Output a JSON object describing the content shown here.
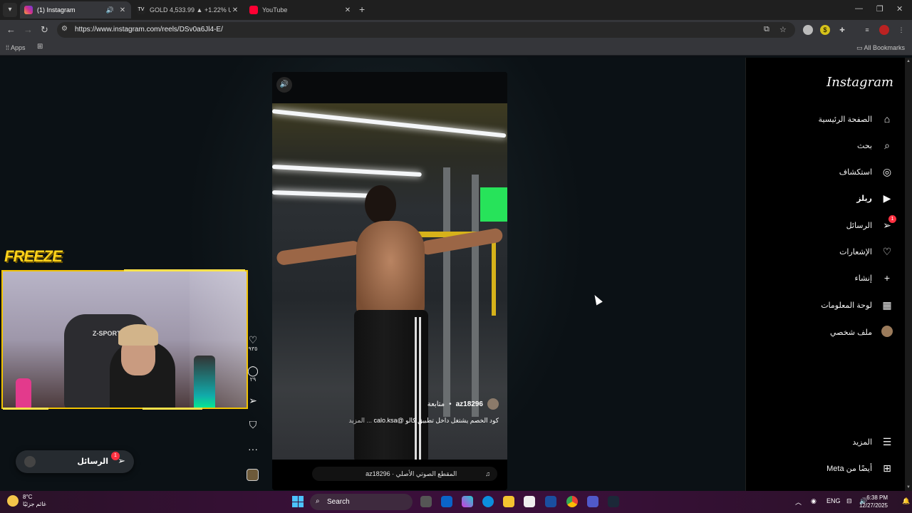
{
  "browser": {
    "tabs": [
      {
        "title": "(1) Instagram",
        "active": true
      },
      {
        "title": "GOLD 4,533.99 ▲ +1.22% Unn",
        "active": false
      },
      {
        "title": "YouTube",
        "active": false
      }
    ],
    "url": "https://www.instagram.com/reels/DSv0a6Jl4-E/",
    "bookmarks": {
      "apps": "Apps",
      "all": "All Bookmarks"
    }
  },
  "overlay": {
    "freeze_logo": "FREEZE",
    "chair_text": "Z-SPORT"
  },
  "reel": {
    "username": "az18296",
    "follow": "متابعة",
    "caption": "كود الخصم يشتغل داخل تطبيق كالو @calo.ksa",
    "more": "... المزيد",
    "audio": "az18296 · المقطع الصوتي الأصلي",
    "likes": "٩٣٥",
    "comments": "٢٩"
  },
  "messages_pill": {
    "label": "الرسائل",
    "badge": "1"
  },
  "sidebar": {
    "logo": "Instagram",
    "items": [
      {
        "label": "الصفحة الرئيسية",
        "icon": "home-icon"
      },
      {
        "label": "بحث",
        "icon": "search-icon"
      },
      {
        "label": "استكشاف",
        "icon": "explore-icon"
      },
      {
        "label": "ريلز",
        "icon": "reels-icon"
      },
      {
        "label": "الرسائل",
        "icon": "messages-icon",
        "badge": "1"
      },
      {
        "label": "الإشعارات",
        "icon": "heart-icon"
      },
      {
        "label": "إنشاء",
        "icon": "plus-icon"
      },
      {
        "label": "لوحة المعلومات",
        "icon": "dashboard-icon"
      },
      {
        "label": "ملف شخصي",
        "icon": "profile-avatar"
      }
    ],
    "more": "المزيد",
    "meta": "أيضًا من Meta"
  },
  "taskbar": {
    "temp": "8°C",
    "weather_desc": "غائم جزئيًا",
    "search": "Search",
    "lang": "ENG",
    "time": "6:38 PM",
    "date": "12/27/2025"
  },
  "colors": {
    "badge": "#ff3040",
    "overlay_accent": "#f2c400"
  }
}
